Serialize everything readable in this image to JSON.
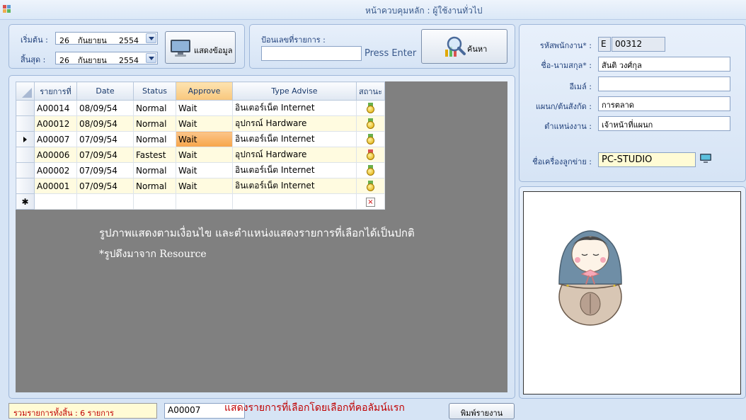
{
  "window": {
    "title": "หน้าควบคุมหลัก : ผู้ใช้งานทั่วไป"
  },
  "filter": {
    "start_label": "เริ่มต้น :",
    "end_label": "สิ้นสุด :",
    "start_date": {
      "day": "26",
      "month": "กันยายน",
      "year": "2554"
    },
    "end_date": {
      "day": "26",
      "month": "กันยายน",
      "year": "2554"
    },
    "show_button_label": "แสดงข้อมูล"
  },
  "search": {
    "label": "ป้อนเลขที่รายการ :",
    "value": "",
    "hint": "Press Enter",
    "button_label": "ค้นหา"
  },
  "employee": {
    "id_label": "รหัสพนักงาน* :",
    "id_prefix": "E",
    "id_value": "00312",
    "name_label": "ชื่อ-นามสกุล* :",
    "name_value": "สันติ วงศ์กุล",
    "email_label": "อีเมล์ :",
    "email_value": "",
    "dept_label": "แผนก/ต้นสังกัด :",
    "dept_value": "การตลาด",
    "position_label": "ตำแหน่งงาน :",
    "position_value": "เจ้าหน้าที่แผนก",
    "computer_label": "ชื่อเครื่องลูกข่าย :",
    "computer_value": "PC-STUDIO"
  },
  "grid": {
    "columns": [
      "รายการที่",
      "Date",
      "Status",
      "Approve",
      "Type Advise",
      "สถานะ"
    ],
    "rows": [
      {
        "id": "A00014",
        "date": "08/09/54",
        "status": "Normal",
        "approve": "Wait",
        "type": "อินเตอร์เน็ต Internet",
        "medal": "gold"
      },
      {
        "id": "A00012",
        "date": "08/09/54",
        "status": "Normal",
        "approve": "Wait",
        "type": "อุปกรณ์ Hardware",
        "medal": "gold"
      },
      {
        "id": "A00007",
        "date": "07/09/54",
        "status": "Normal",
        "approve": "Wait",
        "type": "อินเตอร์เน็ต Internet",
        "medal": "gold"
      },
      {
        "id": "A00006",
        "date": "07/09/54",
        "status": "Fastest",
        "approve": "Wait",
        "type": "อุปกรณ์ Hardware",
        "medal": "red"
      },
      {
        "id": "A00002",
        "date": "07/09/54",
        "status": "Normal",
        "approve": "Wait",
        "type": "อินเตอร์เน็ต Internet",
        "medal": "gold"
      },
      {
        "id": "A00001",
        "date": "07/09/54",
        "status": "Normal",
        "approve": "Wait",
        "type": "อินเตอร์เน็ต Internet",
        "medal": "gold"
      }
    ],
    "new_row_marker": "✱",
    "delete_glyph": "×"
  },
  "overlay": {
    "line1": "รูปภาพแสดงตามเงื่อนไข และตำแหน่งแสดงรายการที่เลือกได้เป็นปกติ",
    "line2": "*รูปดึงมาจาก Resource"
  },
  "footer": {
    "total_label": "รวมรายการทั้งสิ้น : 6 รายการ",
    "selected_id": "A00007",
    "note": "แสดงรายการที่เลือกโดยเลือกที่คอลัมน์แรก",
    "print_button_label": "พิมพ์รายงาน"
  },
  "colors": {
    "accent": "#f8c77d",
    "note_red": "#c00000",
    "label_blue": "#1f3f7a"
  },
  "icons": {
    "app": "app-icon",
    "monitor": "monitor-icon",
    "magnifier": "magnifier-chart-icon",
    "computer": "computer-icon",
    "status_medal": "medal-icon"
  }
}
